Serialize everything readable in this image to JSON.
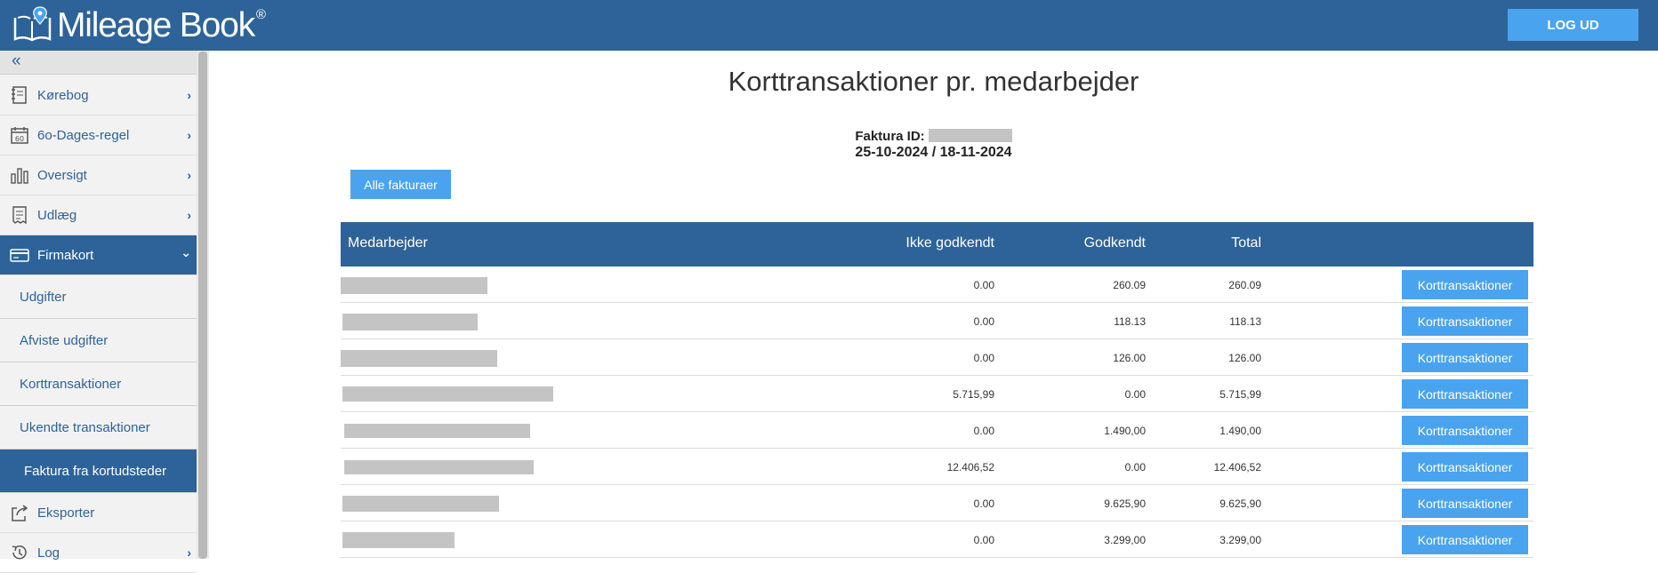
{
  "header": {
    "logo_text": "Mileage Book",
    "logo_reg": "®",
    "logout_label": "LOG UD",
    "brand_color": "#2d6399",
    "button_color": "#4aa3ee"
  },
  "sidebar": {
    "collapse_glyph": "«",
    "items": [
      {
        "label": "Kørebog",
        "icon": "logbook-icon",
        "chevron": "›"
      },
      {
        "label": "6o-Dages-regel",
        "icon": "calendar-60-icon",
        "chevron": "›"
      },
      {
        "label": "Oversigt",
        "icon": "bar-chart-icon",
        "chevron": "›"
      },
      {
        "label": "Udlæg",
        "icon": "receipt-icon",
        "chevron": "›"
      },
      {
        "label": "Firmakort",
        "icon": "credit-card-icon",
        "chevron": "⌄"
      }
    ],
    "subitems": [
      {
        "label": "Udgifter"
      },
      {
        "label": "Afviste udgifter"
      },
      {
        "label": "Korttransaktioner"
      },
      {
        "label": "Ukendte transaktioner"
      },
      {
        "label": "Faktura fra kortudsteder"
      }
    ],
    "bottom_items": [
      {
        "label": "Eksporter",
        "icon": "export-icon"
      },
      {
        "label": "Log",
        "icon": "history-icon",
        "chevron": "›"
      }
    ]
  },
  "main": {
    "title": "Korttransaktioner pr. medarbejder",
    "invoice_label": "Faktura ID:",
    "invoice_dates": "25-10-2024 / 18-11-2024",
    "all_invoices_label": "Alle fakturaer",
    "table": {
      "headers": {
        "employee": "Medarbejder",
        "not_approved": "Ikke godkendt",
        "approved": "Godkendt",
        "total": "Total"
      },
      "button_label": "Korttransaktioner",
      "rows": [
        {
          "not_approved": "0.00",
          "approved": "260.09",
          "total": "260.09"
        },
        {
          "not_approved": "0.00",
          "approved": "118.13",
          "total": "118.13"
        },
        {
          "not_approved": "0.00",
          "approved": "126.00",
          "total": "126.00"
        },
        {
          "not_approved": "5.715,99",
          "approved": "0.00",
          "total": "5.715,99"
        },
        {
          "not_approved": "0.00",
          "approved": "1.490,00",
          "total": "1.490,00"
        },
        {
          "not_approved": "12.406,52",
          "approved": "0.00",
          "total": "12.406,52"
        },
        {
          "not_approved": "0.00",
          "approved": "9.625,90",
          "total": "9.625,90"
        },
        {
          "not_approved": "0.00",
          "approved": "3.299,00",
          "total": "3.299,00"
        }
      ]
    }
  }
}
